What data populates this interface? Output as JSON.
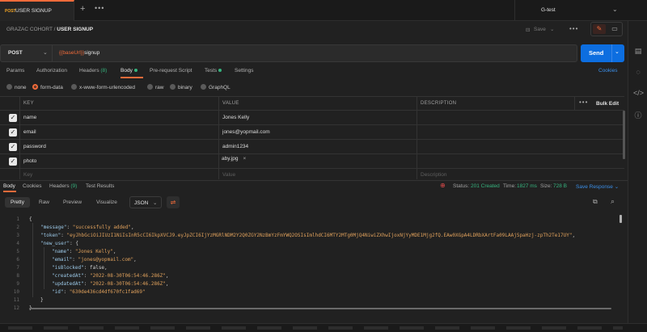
{
  "tabbar": {
    "tab_method": "POST",
    "tab_title": "USER SIGNUP",
    "close_icon": "close-icon",
    "plus_icon": "plus-icon",
    "more_icon": "more-horizontal-icon",
    "env_name": "G-test"
  },
  "breadcrumb": {
    "collection": "GRAZAC COHORT",
    "separator": "/",
    "request": "USER SIGNUP"
  },
  "toolbar": {
    "save_label": "Save"
  },
  "request": {
    "method": "POST",
    "url_var": "{{baseUrl}}",
    "url_path": "signup",
    "send_label": "Send"
  },
  "req_tabs": {
    "params": "Params",
    "authorization": "Authorization",
    "headers": "Headers",
    "headers_count": "(8)",
    "body": "Body",
    "pre_request": "Pre-request Script",
    "tests": "Tests",
    "settings": "Settings",
    "cookies": "Cookies"
  },
  "body_types": {
    "none": "none",
    "form_data": "form-data",
    "urlencoded": "x-www-form-urlencoded",
    "raw": "raw",
    "binary": "binary",
    "graphql": "GraphQL",
    "selected": "form-data"
  },
  "table": {
    "headers": {
      "key": "KEY",
      "value": "VALUE",
      "description": "DESCRIPTION",
      "bulk_edit": "Bulk Edit"
    },
    "rows": [
      {
        "key": "name",
        "value": "Jones Kelly"
      },
      {
        "key": "email",
        "value": "jones@yopmail.com"
      },
      {
        "key": "password",
        "value": "admin1234"
      },
      {
        "key": "photo",
        "value": "aby.jpg"
      }
    ],
    "placeholder": {
      "key": "Key",
      "value": "Value",
      "description": "Description"
    }
  },
  "response": {
    "tabs": {
      "body": "Body",
      "cookies": "Cookies",
      "headers": "Headers",
      "headers_count": "(9)",
      "test_results": "Test Results"
    },
    "status_label": "Status:",
    "status_value": "201 Created",
    "time_label": "Time:",
    "time_value": "1827 ms",
    "size_label": "Size:",
    "size_value": "728 B",
    "save_response": "Save Response",
    "formats": {
      "pretty": "Pretty",
      "raw": "Raw",
      "preview": "Preview",
      "visualize": "Visualize",
      "json": "JSON"
    },
    "code": {
      "message_key": "\"message\"",
      "message_val": "\"successfully added\"",
      "token_key": "\"token\"",
      "token_val": "\"eyJhbGciOiJIUzI1NiIsInR5cCI6IkpXVCJ9.eyJpZCI6IjYzMGRlNDM2Y2Q0ZGY2NzBmYzFmYWQ2OSIsImlhdCI6MTY2MTg0MjQ4NiwiZXhwIjoxNjYyMDE1Mjg2fQ.EAw0XGpA4LDRbXArtFa09LAAjSpaHzj-zpTh2Te17UY\"",
      "new_user_key": "\"new_user\"",
      "name_key": "\"name\"",
      "name_val": "\"Jones Kelly\"",
      "email_key": "\"email\"",
      "email_val": "\"jones@yopmail.com\"",
      "blocked_key": "\"isBlocked\"",
      "blocked_val": "false",
      "created_key": "\"createdAt\"",
      "created_val": "\"2022-08-30T06:54:46.286Z\"",
      "updated_key": "\"updatedAt\"",
      "updated_val": "\"2022-08-30T06:54:46.286Z\"",
      "id_key": "\"id\"",
      "id_val": "\"630de436cd4df670fc1fad69\""
    },
    "line_numbers": [
      "1",
      "2",
      "3",
      "4",
      "5",
      "6",
      "7",
      "8",
      "9",
      "10",
      "11",
      "12"
    ]
  },
  "colors": {
    "accent": "#f26b3a",
    "send": "#0d6ee0",
    "success": "#36b37e",
    "link": "#3b8fe8"
  }
}
